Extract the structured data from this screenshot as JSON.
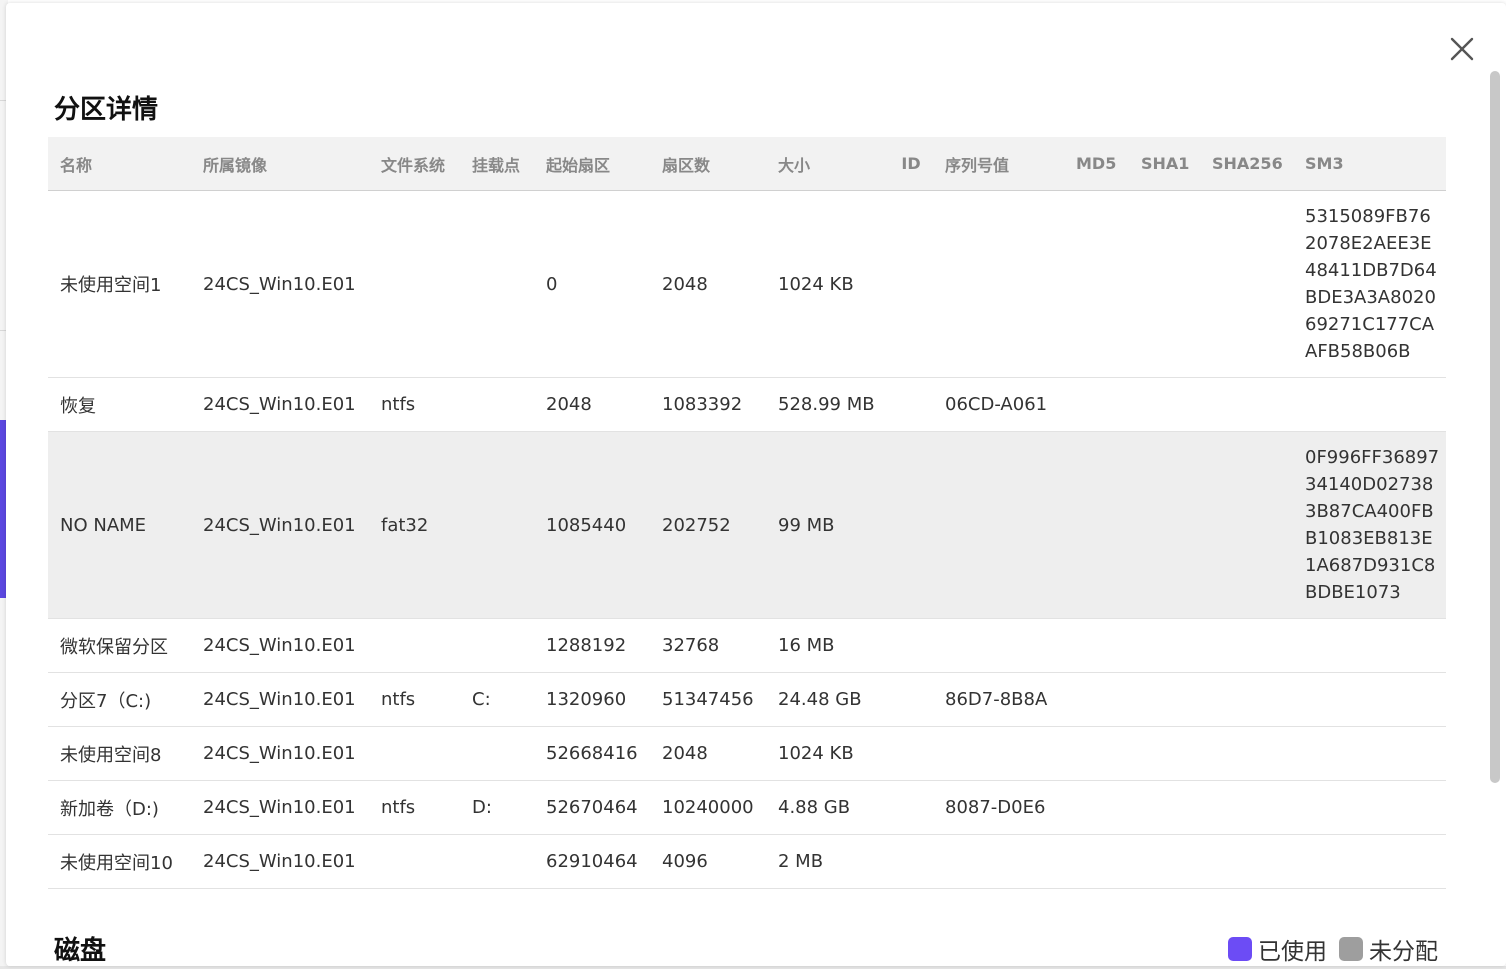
{
  "modal": {
    "partition_title": "分区详情",
    "disk_title": "磁盘"
  },
  "table": {
    "headers": [
      "名称",
      "所属镜像",
      "文件系统",
      "挂载点",
      "起始扇区",
      "扇区数",
      "大小",
      "ID",
      "序列号值",
      "MD5",
      "SHA1",
      "SHA256",
      "SM3"
    ],
    "rows": [
      {
        "name": "未使用空间1",
        "image": "24CS_Win10.E01",
        "fs": "",
        "mount": "",
        "start": "0",
        "count": "2048",
        "size": "1024 KB",
        "id": "",
        "serial": "",
        "md5": "",
        "sha1": "",
        "sha256": "",
        "sm3": [
          "5315089FB76",
          "2078E2AEE3E",
          "48411DB7D64",
          "BDE3A3A8020",
          "69271C177CA",
          "AFB58B06B"
        ]
      },
      {
        "name": "恢复",
        "image": "24CS_Win10.E01",
        "fs": "ntfs",
        "mount": "",
        "start": "2048",
        "count": "1083392",
        "size": "528.99 MB",
        "id": "",
        "serial": "06CD-A061",
        "md5": "",
        "sha1": "",
        "sha256": "",
        "sm3": []
      },
      {
        "name": "NO NAME",
        "image": "24CS_Win10.E01",
        "fs": "fat32",
        "mount": "",
        "start": "1085440",
        "count": "202752",
        "size": "99 MB",
        "id": "",
        "serial": "",
        "md5": "",
        "sha1": "",
        "sha256": "",
        "sm3": [
          "0F996FF36897",
          "34140D02738",
          "3B87CA400FB",
          "B1083EB813E",
          "1A687D931C8",
          "BDBE1073"
        ]
      },
      {
        "name": "微软保留分区",
        "image": "24CS_Win10.E01",
        "fs": "",
        "mount": "",
        "start": "1288192",
        "count": "32768",
        "size": "16 MB",
        "id": "",
        "serial": "",
        "md5": "",
        "sha1": "",
        "sha256": "",
        "sm3": []
      },
      {
        "name": "分区7（C:)",
        "image": "24CS_Win10.E01",
        "fs": "ntfs",
        "mount": "C:",
        "start": "1320960",
        "count": "51347456",
        "size": "24.48 GB",
        "id": "",
        "serial": "86D7-8B8A",
        "md5": "",
        "sha1": "",
        "sha256": "",
        "sm3": []
      },
      {
        "name": "未使用空间8",
        "image": "24CS_Win10.E01",
        "fs": "",
        "mount": "",
        "start": "52668416",
        "count": "2048",
        "size": "1024 KB",
        "id": "",
        "serial": "",
        "md5": "",
        "sha1": "",
        "sha256": "",
        "sm3": []
      },
      {
        "name": "新加卷（D:)",
        "image": "24CS_Win10.E01",
        "fs": "ntfs",
        "mount": "D:",
        "start": "52670464",
        "count": "10240000",
        "size": "4.88 GB",
        "id": "",
        "serial": "8087-D0E6",
        "md5": "",
        "sha1": "",
        "sha256": "",
        "sm3": []
      },
      {
        "name": "未使用空间10",
        "image": "24CS_Win10.E01",
        "fs": "",
        "mount": "",
        "start": "62910464",
        "count": "4096",
        "size": "2 MB",
        "id": "",
        "serial": "",
        "md5": "",
        "sha1": "",
        "sha256": "",
        "sm3": []
      }
    ],
    "highlighted_row": 2
  },
  "legend": [
    {
      "label": "已使用",
      "color": "#6c4cf5"
    },
    {
      "label": "未分配",
      "color": "#9e9e9e"
    }
  ],
  "icons": {
    "close": "close-icon"
  }
}
